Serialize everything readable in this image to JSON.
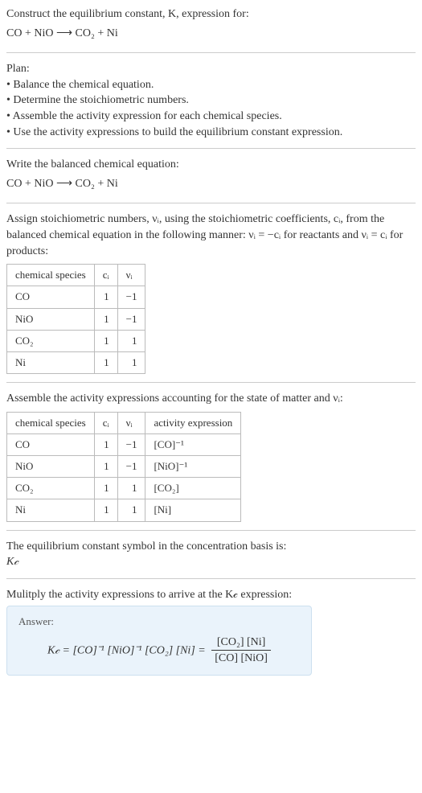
{
  "intro": {
    "line1": "Construct the equilibrium constant, K, expression for:",
    "equation": "CO + NiO ⟶ CO₂ + Ni"
  },
  "plan": {
    "heading": "Plan:",
    "items": [
      "• Balance the chemical equation.",
      "• Determine the stoichiometric numbers.",
      "• Assemble the activity expression for each chemical species.",
      "• Use the activity expressions to build the equilibrium constant expression."
    ]
  },
  "balanced": {
    "heading": "Write the balanced chemical equation:",
    "equation": "CO + NiO ⟶ CO₂ + Ni"
  },
  "stoich": {
    "text": "Assign stoichiometric numbers, νᵢ, using the stoichiometric coefficients, cᵢ, from the balanced chemical equation in the following manner: νᵢ = −cᵢ for reactants and νᵢ = cᵢ for products:",
    "headers": {
      "species": "chemical species",
      "ci": "cᵢ",
      "vi": "νᵢ"
    },
    "rows": [
      {
        "species": "CO",
        "ci": "1",
        "vi": "−1"
      },
      {
        "species": "NiO",
        "ci": "1",
        "vi": "−1"
      },
      {
        "species": "CO₂",
        "ci": "1",
        "vi": "1"
      },
      {
        "species": "Ni",
        "ci": "1",
        "vi": "1"
      }
    ]
  },
  "activity": {
    "text": "Assemble the activity expressions accounting for the state of matter and νᵢ:",
    "headers": {
      "species": "chemical species",
      "ci": "cᵢ",
      "vi": "νᵢ",
      "act": "activity expression"
    },
    "rows": [
      {
        "species": "CO",
        "ci": "1",
        "vi": "−1",
        "act": "[CO]⁻¹"
      },
      {
        "species": "NiO",
        "ci": "1",
        "vi": "−1",
        "act": "[NiO]⁻¹"
      },
      {
        "species": "CO₂",
        "ci": "1",
        "vi": "1",
        "act": "[CO₂]"
      },
      {
        "species": "Ni",
        "ci": "1",
        "vi": "1",
        "act": "[Ni]"
      }
    ]
  },
  "symbol": {
    "text": "The equilibrium constant symbol in the concentration basis is:",
    "value": "K𝒸"
  },
  "multiply": {
    "text": "Mulitply the activity expressions to arrive at the K𝒸 expression:"
  },
  "answer": {
    "label": "Answer:",
    "lhs": "K𝒸 = [CO]⁻¹ [NiO]⁻¹ [CO₂] [Ni] =",
    "frac_top": "[CO₂] [Ni]",
    "frac_bot": "[CO] [NiO]"
  },
  "chart_data": {
    "type": "table",
    "tables": [
      {
        "title": "Stoichiometric numbers",
        "columns": [
          "chemical species",
          "c_i",
          "ν_i"
        ],
        "rows": [
          [
            "CO",
            1,
            -1
          ],
          [
            "NiO",
            1,
            -1
          ],
          [
            "CO2",
            1,
            1
          ],
          [
            "Ni",
            1,
            1
          ]
        ]
      },
      {
        "title": "Activity expressions",
        "columns": [
          "chemical species",
          "c_i",
          "ν_i",
          "activity expression"
        ],
        "rows": [
          [
            "CO",
            1,
            -1,
            "[CO]^-1"
          ],
          [
            "NiO",
            1,
            -1,
            "[NiO]^-1"
          ],
          [
            "CO2",
            1,
            1,
            "[CO2]"
          ],
          [
            "Ni",
            1,
            1,
            "[Ni]"
          ]
        ]
      }
    ]
  }
}
